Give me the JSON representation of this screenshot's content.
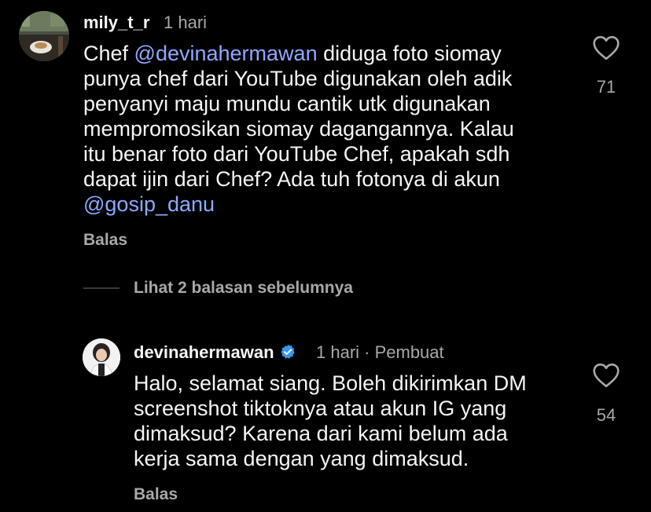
{
  "comment1": {
    "username": "mily_t_r",
    "time": "1 hari",
    "text_parts": {
      "p1": "Chef ",
      "mention1": "@devinahermawan",
      "p2": " diduga foto siomay\npunya chef dari YouTube digunakan oleh  adik\npenyanyi maju mundu cantik utk digunakan\nmempromosikan siomay dagangannya. Kalau\nitu benar foto dari YouTube Chef, apakah sdh\ndapat ijin dari Chef? Ada tuh fotonya di akun\n",
      "mention2": "@gosip_danu"
    },
    "reply_label": "Balas",
    "like_count": "71",
    "like_icon": "heart-outline-icon"
  },
  "view_replies": {
    "label": "Lihat 2 balasan sebelumnya"
  },
  "comment2": {
    "username": "devinahermawan",
    "verified_icon": "verified-badge-icon",
    "time_meta": "1 hari · Pembuat",
    "text": "Halo, selamat siang. Boleh dikirimkan DM\nscreenshot tiktoknya atau akun IG yang\ndimaksud? Karena dari kami belum ada\nkerja sama dengan yang dimaksud.",
    "reply_label": "Balas",
    "like_count": "54",
    "like_icon": "heart-outline-icon"
  },
  "colors": {
    "background": "#000000",
    "text": "#f5f5f5",
    "secondary": "#a8a8a8",
    "mention": "#8fa8ff",
    "verified": "#3897f0"
  }
}
